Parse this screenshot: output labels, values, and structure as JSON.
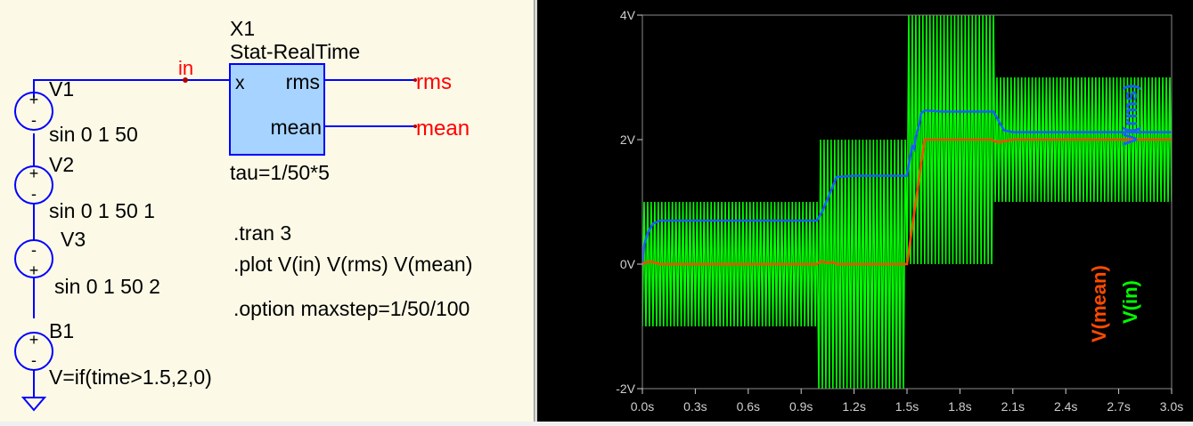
{
  "schematic": {
    "net_in": "in",
    "block_ref": "X1",
    "block_type": "Stat-RealTime",
    "pin_x": "x",
    "pin_rms": "rms",
    "pin_mean": "mean",
    "block_param": "tau=1/50*5",
    "label_rms": "rms",
    "label_mean": "mean",
    "v1_name": "V1",
    "v1_value": "sin 0 1 50",
    "v2_name": "V2",
    "v2_value": "sin 0 1 50 1",
    "v3_name": "V3",
    "v3_value": "sin 0 1 50 2",
    "b1_name": "B1",
    "b1_value": "V=if(time>1.5,2,0)",
    "directives": [
      ".tran 3",
      ".plot V(in) V(rms) V(mean)",
      ".option maxstep=1/50/100"
    ]
  },
  "plot": {
    "trace_label_rms": "V(rms)",
    "trace_label_mean": "V(mean)",
    "trace_label_in": "V(in)",
    "y_ticks": [
      "4V",
      "2V",
      "0V",
      "-2V"
    ],
    "x_ticks": [
      "0.0s",
      "0.3s",
      "0.6s",
      "0.9s",
      "1.2s",
      "1.5s",
      "1.8s",
      "2.1s",
      "2.4s",
      "2.7s",
      "3.0s"
    ]
  },
  "chart_data": {
    "type": "line",
    "xlim": [
      0,
      3
    ],
    "ylim": [
      -2,
      4
    ],
    "grid": false,
    "series": [
      {
        "name": "V(in)",
        "color": "#00ff00",
        "envelope": {
          "x": [
            0,
            1,
            1.5,
            2,
            3
          ],
          "upper": [
            1,
            2,
            4,
            3,
            3
          ],
          "lower": [
            -1,
            -2,
            0,
            1,
            1
          ]
        }
      },
      {
        "name": "V(rms)",
        "color": "#1c5cff",
        "x": [
          0,
          0.01,
          0.03,
          0.06,
          0.1,
          0.2,
          0.5,
          0.99,
          1.02,
          1.05,
          1.08,
          1.1,
          1.2,
          1.5,
          1.51,
          1.52,
          1.53,
          1.54,
          1.55,
          1.56,
          1.57,
          1.58,
          1.6,
          1.7,
          1.99,
          2.01,
          2.03,
          2.05,
          2.1,
          2.5,
          3.0
        ],
        "y": [
          0,
          0.3,
          0.5,
          0.65,
          0.7,
          0.7,
          0.7,
          0.7,
          0.85,
          1.05,
          1.25,
          1.4,
          1.42,
          1.42,
          1.6,
          1.75,
          1.9,
          1.85,
          2.05,
          2.15,
          2.25,
          2.42,
          2.47,
          2.45,
          2.45,
          2.35,
          2.25,
          2.15,
          2.12,
          2.12,
          2.12
        ]
      },
      {
        "name": "V(mean)",
        "color": "#ff4a00",
        "x": [
          0,
          0.02,
          0.05,
          0.1,
          0.99,
          1.0,
          1.02,
          1.05,
          1.08,
          1.1,
          1.49,
          1.5,
          1.53,
          1.6,
          1.98,
          2.0,
          2.03,
          2.06,
          2.1,
          3.0
        ],
        "y": [
          0,
          0.03,
          0.04,
          0.0,
          0.0,
          0.03,
          0.04,
          0.02,
          0.03,
          0.0,
          0.0,
          0.0,
          0.6,
          2.0,
          2.0,
          1.97,
          1.96,
          1.98,
          2.0,
          2.0
        ]
      }
    ]
  }
}
